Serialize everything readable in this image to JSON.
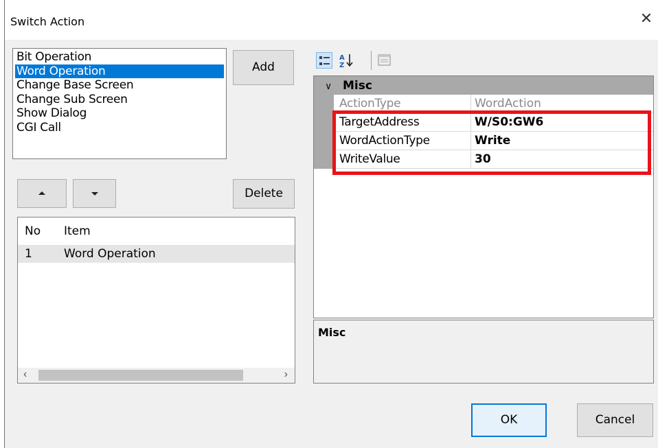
{
  "window": {
    "title": "Switch Action",
    "close_glyph": "✕"
  },
  "actions": {
    "items": [
      "Bit Operation",
      "Word Operation",
      "Change Base Screen",
      "Change Sub Screen",
      "Show Dialog",
      "CGI Call"
    ],
    "selected": "Word Operation"
  },
  "buttons": {
    "add": "Add",
    "delete": "Delete",
    "ok": "OK",
    "cancel": "Cancel"
  },
  "item_table": {
    "headers": {
      "no": "No",
      "item": "Item"
    },
    "rows": [
      {
        "no": "1",
        "item": "Word Operation"
      }
    ]
  },
  "property_grid": {
    "category": "Misc",
    "properties": [
      {
        "name": "ActionType",
        "value": "WordAction",
        "readonly": true
      },
      {
        "name": "TargetAddress",
        "value": "W/S0:GW6"
      },
      {
        "name": "WordActionType",
        "value": "Write"
      },
      {
        "name": "WriteValue",
        "value": "30"
      }
    ],
    "description_title": "Misc"
  },
  "colors": {
    "selection": "#0078d7",
    "highlight_box": "#e8141a",
    "category_band": "#a9a9a9"
  }
}
